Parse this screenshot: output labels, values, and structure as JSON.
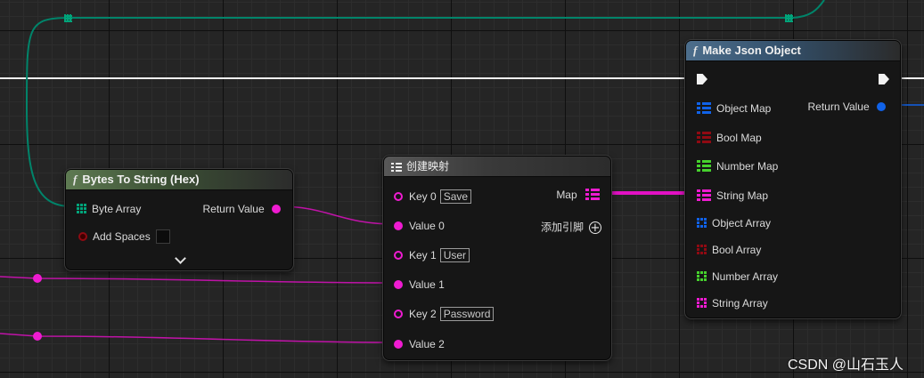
{
  "colors": {
    "string_pin": "#ef1bd1",
    "bytes_pin": "#00a47a",
    "bool_pin": "#8f0a12",
    "object_pin": "#1062e8",
    "number_pin": "#46d12d",
    "exec_pin": "#f2f2f2"
  },
  "bytes_node": {
    "title": "Bytes To String (Hex)",
    "icon": "function-icon",
    "byte_array_label": "Byte Array",
    "add_spaces_label": "Add Spaces",
    "return_label": "Return Value",
    "expand_icon": "chevron-down-icon"
  },
  "map_node": {
    "title": "创建映射",
    "icon": "make-map-icon",
    "map_label": "Map",
    "add_pin_label": "添加引脚",
    "rows": [
      {
        "key_label": "Key 0",
        "key_value": "Save",
        "value_label": "Value 0"
      },
      {
        "key_label": "Key 1",
        "key_value": "User",
        "value_label": "Value 1"
      },
      {
        "key_label": "Key 2",
        "key_value": "Password",
        "value_label": "Value 2"
      }
    ]
  },
  "json_node": {
    "title": "Make Json Object",
    "icon": "function-icon",
    "return_label": "Return Value",
    "inputs": [
      {
        "label": "Object Map",
        "color": "#1062e8",
        "kind": "map"
      },
      {
        "label": "Bool Map",
        "color": "#8f0a12",
        "kind": "map"
      },
      {
        "label": "Number Map",
        "color": "#46d12d",
        "kind": "map"
      },
      {
        "label": "String Map",
        "color": "#ef1bd1",
        "kind": "map"
      },
      {
        "label": "Object Array",
        "color": "#1062e8",
        "kind": "array"
      },
      {
        "label": "Bool Array",
        "color": "#8f0a12",
        "kind": "array"
      },
      {
        "label": "Number Array",
        "color": "#46d12d",
        "kind": "array"
      },
      {
        "label": "String Array",
        "color": "#ef1bd1",
        "kind": "array"
      }
    ]
  },
  "watermark": "CSDN @山石玉人"
}
